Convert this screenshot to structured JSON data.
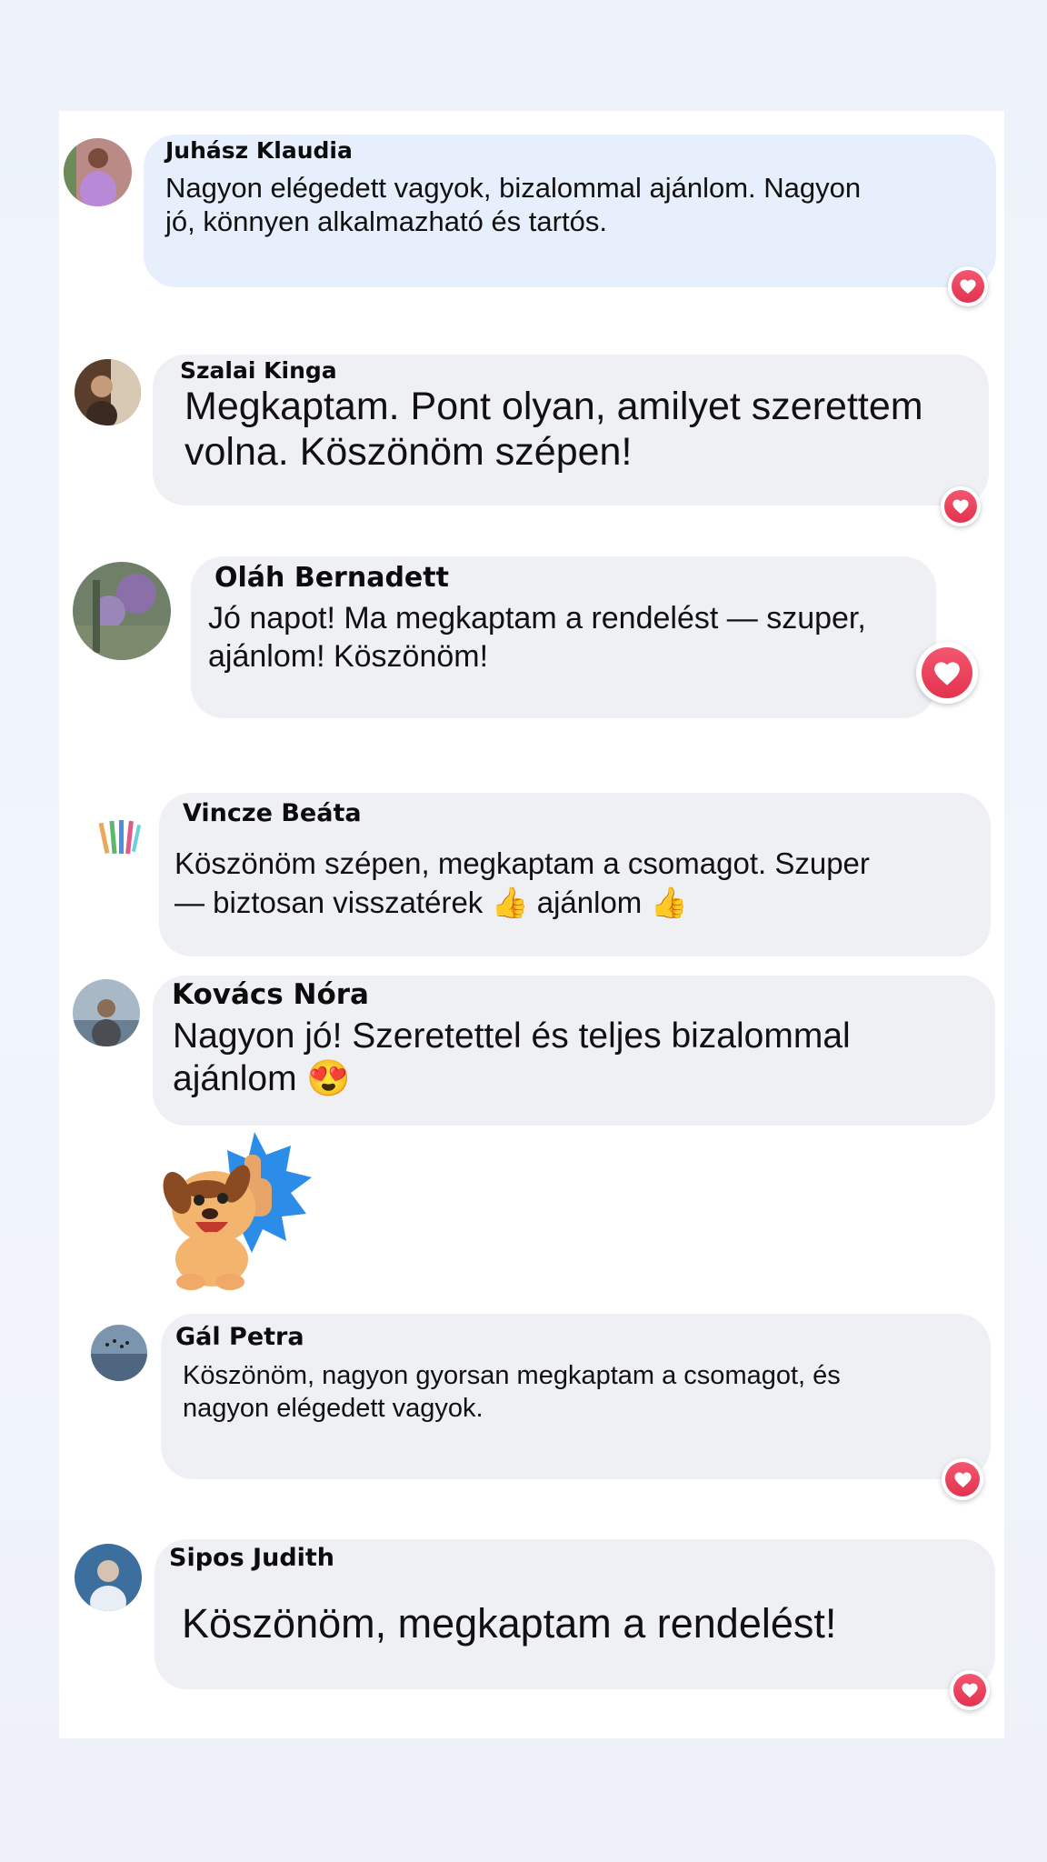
{
  "colors": {
    "bubble_gray": "#eef0f4",
    "bubble_blue": "#e6effb",
    "heart_red": "#e9405b",
    "text": "#111111"
  },
  "comments": [
    {
      "author": "Juhász Klaudia",
      "text": "Nagyon elégedett vagyok, bizalommal ajánlom. Nagyon\njó, könnyen alkalmazható és tartós.",
      "reaction": "heart-icon"
    },
    {
      "author": "Szalai Kinga",
      "text": "Megkaptam. Pont olyan, amilyet szerettem\nvolna. Köszönöm szépen!",
      "reaction": "heart-icon"
    },
    {
      "author": "Oláh Bernadett",
      "text": "Jó napot! Ma megkaptam a rendelést — szuper,\najánlom! Köszönöm!",
      "reaction": "heart-icon"
    },
    {
      "author": "Vincze Beáta",
      "text": "Köszönöm szépen, megkaptam a csomagot. Szuper\n— biztosan visszatérek 👍 ajánlom 👍"
    },
    {
      "author": "Kovács Nóra",
      "text": "Nagyon jó! Szeretettel és teljes bizalommal\najánlom 😍",
      "sticker": "thumbs-up-dog-sticker"
    },
    {
      "author": "Gál Petra",
      "text": "Köszönöm, nagyon gyorsan megkaptam a csomagot, és\nnagyon elégedett vagyok.",
      "reaction": "heart-icon"
    },
    {
      "author": "Sipos Judith",
      "text": "Köszönöm, megkaptam a rendelést!",
      "reaction": "heart-icon"
    }
  ]
}
